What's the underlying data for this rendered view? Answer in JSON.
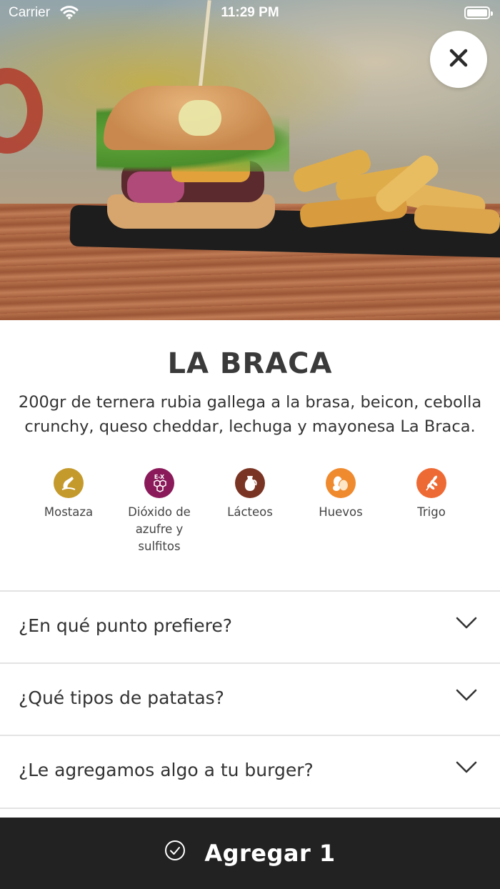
{
  "status_bar": {
    "carrier": "Carrier",
    "time": "11:29 PM"
  },
  "product": {
    "title": "LA BRACA",
    "description": "200gr de ternera rubia gallega a la brasa, beicon, cebolla crunchy, queso cheddar, lechuga y mayonesa La Braca."
  },
  "allergens": [
    {
      "label": "Mostaza",
      "icon": "mustard-icon",
      "color": "#c49a2c"
    },
    {
      "label": "Dióxido de azufre y sulfitos",
      "icon": "sulphites-icon",
      "color": "#8a1a5a"
    },
    {
      "label": "Lácteos",
      "icon": "dairy-jug-icon",
      "color": "#7a3424"
    },
    {
      "label": "Huevos",
      "icon": "eggs-icon",
      "color": "#ef8a2e"
    },
    {
      "label": "Trigo",
      "icon": "wheat-icon",
      "color": "#ee6a34"
    }
  ],
  "options": [
    {
      "question": "¿En qué punto prefiere?"
    },
    {
      "question": "¿Qué tipos de patatas?"
    },
    {
      "question": "¿Le agregamos algo a tu burger?"
    }
  ],
  "add_button": {
    "label": "Agregar 1"
  },
  "colors": {
    "bottom_bar": "#222222",
    "text": "#333333",
    "divider": "#e3e3e3"
  }
}
